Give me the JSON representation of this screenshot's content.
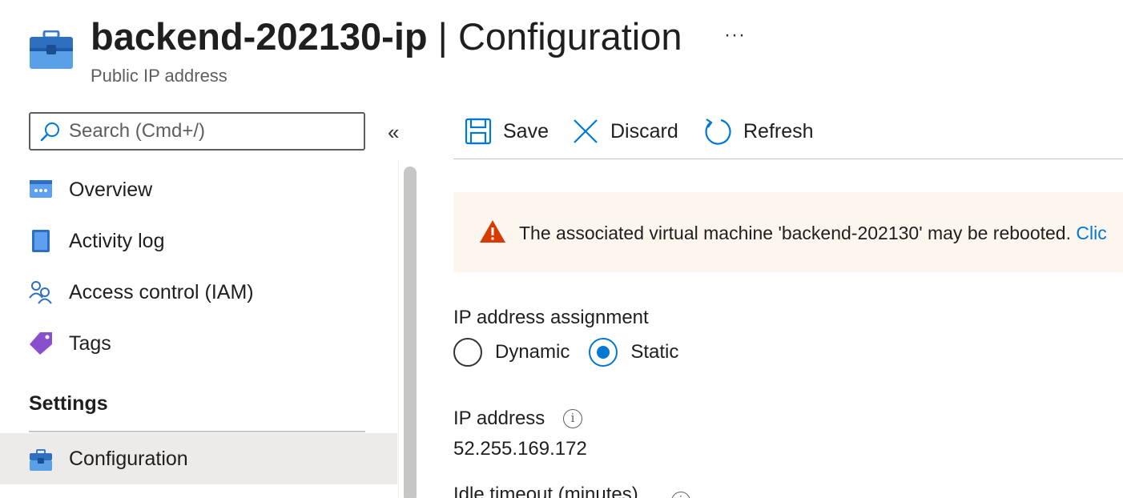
{
  "header": {
    "resource_name": "backend-202130-ip",
    "separator": "|",
    "blade_name": "Configuration",
    "more_label": "···",
    "subtitle": "Public IP address"
  },
  "sidebar": {
    "search_placeholder": "Search (Cmd+/)",
    "collapse_label": "«",
    "items": [
      {
        "label": "Overview",
        "icon": "overview-icon"
      },
      {
        "label": "Activity log",
        "icon": "activity-log-icon"
      },
      {
        "label": "Access control (IAM)",
        "icon": "access-control-icon"
      },
      {
        "label": "Tags",
        "icon": "tag-icon"
      }
    ],
    "section_header": "Settings",
    "settings_items": [
      {
        "label": "Configuration",
        "icon": "configuration-icon",
        "active": true
      }
    ]
  },
  "toolbar": {
    "save_label": "Save",
    "discard_label": "Discard",
    "refresh_label": "Refresh"
  },
  "banner": {
    "message": "The associated virtual machine 'backend-202130' may be rebooted. ",
    "link_text": "Clic",
    "icon": "warning-icon"
  },
  "form": {
    "assignment_label": "IP address assignment",
    "options": [
      {
        "label": "Dynamic",
        "checked": false
      },
      {
        "label": "Static",
        "checked": true
      }
    ],
    "ip_label": "IP address",
    "ip_value": "52.255.169.172",
    "idle_label": "Idle timeout (minutes)"
  },
  "colors": {
    "accent": "#0078d4",
    "warning": "#d83b01",
    "banner_bg": "#fdf6ef",
    "active_item_bg": "#edebe9"
  }
}
